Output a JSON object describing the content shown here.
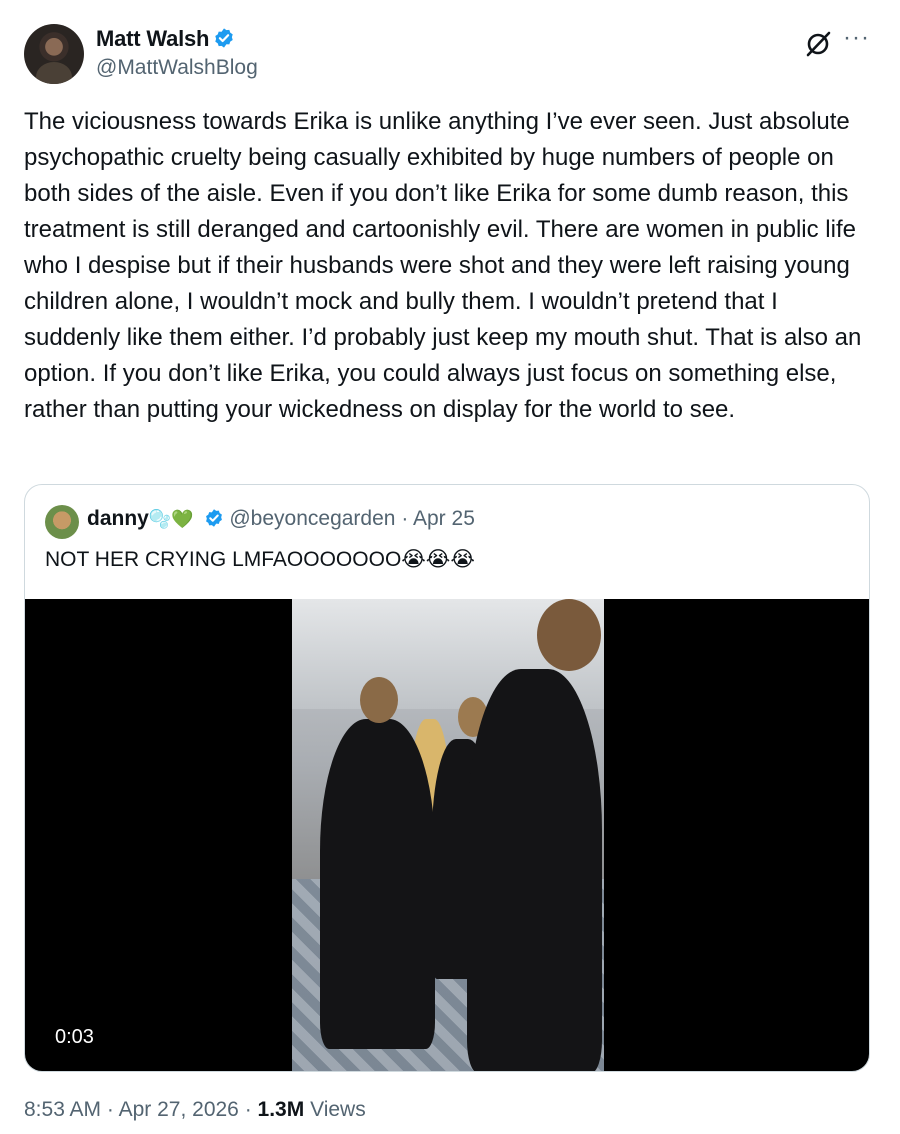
{
  "author": {
    "name": "Matt Walsh",
    "handle": "@MattWalshBlog"
  },
  "tweet": {
    "text": "The viciousness towards Erika is unlike anything I’ve ever seen. Just absolute psychopathic cruelty being casually exhibited by huge numbers of people on both sides of the aisle. Even if you don’t like Erika for some dumb reason, this treatment is still deranged and cartoonishly evil. There are women in public life who I despise but if their husbands were shot and they were left raising young children alone, I wouldn’t mock and bully them. I wouldn’t pretend that I suddenly like them either. I’d probably just keep my mouth shut. That is also an option. If you don’t like Erika, you could always just focus on something else, rather than putting your wickedness on display for the world to see."
  },
  "quote": {
    "name": "danny",
    "emojis": "🫧💚",
    "handle": "@beyoncegarden",
    "separator": "·",
    "date": "Apr 25",
    "text": "NOT HER CRYING LMFAOOOOOOO😭😭😭",
    "video_time": "0:03"
  },
  "meta": {
    "time": "8:53 AM",
    "sep1": "·",
    "date": "Apr 27, 2026",
    "sep2": "·",
    "views_count": "1.3M",
    "views_label": "Views"
  },
  "colors": {
    "verified": "#1d9bf0",
    "secondary_text": "#536471",
    "border": "#cfd9de"
  },
  "icons": [
    "verified-badge-icon",
    "grok-icon",
    "more-icon"
  ]
}
